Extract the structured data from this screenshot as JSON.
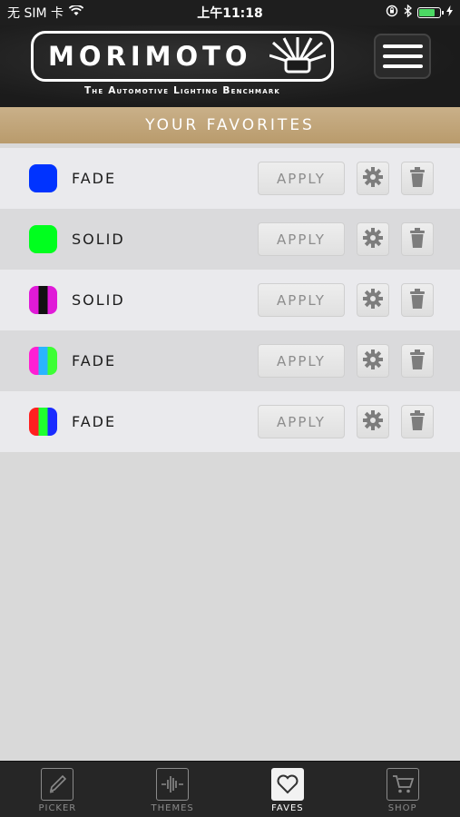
{
  "status_bar": {
    "carrier": "无 SIM 卡",
    "time": "上午11:18",
    "battery_level": 0.7
  },
  "header": {
    "logo_text": "MORIMOTO",
    "tagline": "The Automotive Lighting Benchmark"
  },
  "banner": {
    "title": "YOUR FAVORITES"
  },
  "favorites": [
    {
      "mode": "FADE",
      "apply_label": "APPLY",
      "colors": [
        "#0033ff"
      ]
    },
    {
      "mode": "SOLID",
      "apply_label": "APPLY",
      "colors": [
        "#00ff1e"
      ]
    },
    {
      "mode": "SOLID",
      "apply_label": "APPLY",
      "colors": [
        "#e01ad8",
        "#111111",
        "#e01ad8"
      ]
    },
    {
      "mode": "FADE",
      "apply_label": "APPLY",
      "colors": [
        "#ff1fd4",
        "#2ab5ff",
        "#3cff35"
      ]
    },
    {
      "mode": "FADE",
      "apply_label": "APPLY",
      "colors": [
        "#ff2020",
        "#20ff30",
        "#1a2cff"
      ]
    }
  ],
  "tabs": [
    {
      "label": "PICKER",
      "icon": "pencil-icon",
      "active": false
    },
    {
      "label": "THEMES",
      "icon": "waveform-icon",
      "active": false
    },
    {
      "label": "FAVES",
      "icon": "heart-icon",
      "active": true
    },
    {
      "label": "SHOP",
      "icon": "cart-icon",
      "active": false
    }
  ]
}
